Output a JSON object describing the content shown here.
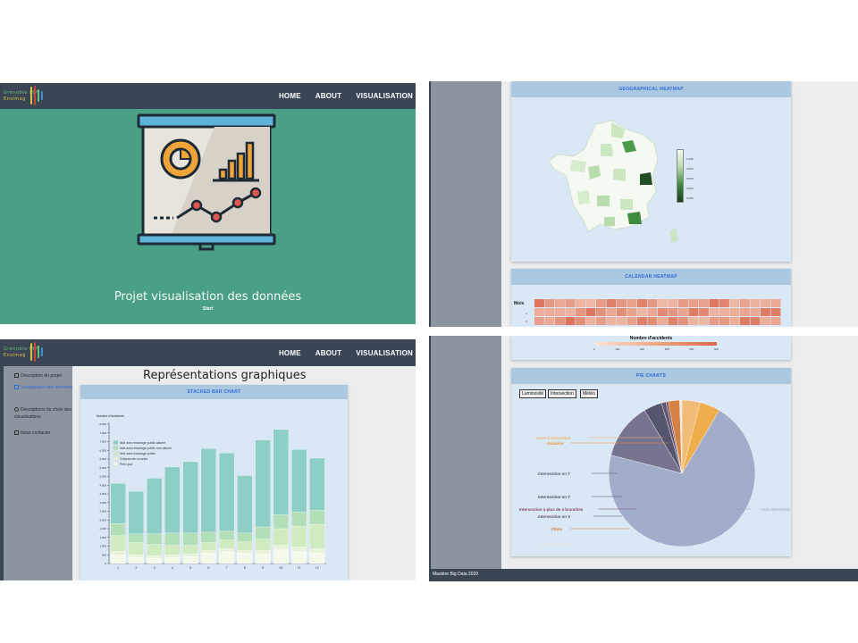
{
  "nav": {
    "logo_line1": "Grenoble INP",
    "logo_line2": "Ensimag",
    "links": [
      "HOME",
      "ABOUT",
      "VISUALISATION"
    ]
  },
  "home": {
    "title": "Projet visualisation des données",
    "start": "Start"
  },
  "geo_map": {
    "header": "GEOGRAPHICAL HEATMAP",
    "legend_ticks": [
      "1,000",
      "2,000",
      "3,000",
      "4,000",
      "5,000"
    ]
  },
  "calendar": {
    "header": "CALENDAR HEATMAP",
    "y_label": "Mois",
    "row_labels": [
      "2",
      "3",
      "4"
    ],
    "legend_title": "Nombre d'accidents",
    "legend_ticks": [
      "0",
      "100",
      "200",
      "300",
      "400",
      "500"
    ],
    "colors": {
      "low": "#fbe4d6",
      "high": "#d9684e"
    }
  },
  "sidebar": {
    "items": [
      {
        "label": "Description du projet",
        "active": false
      },
      {
        "label": "Visualisation des données",
        "active": true
      },
      {
        "label": "Descriptions du choix des visualisations",
        "active": false
      },
      {
        "label": "Nous contacter",
        "active": false
      }
    ]
  },
  "viz_page": {
    "title": "Représentations graphiques"
  },
  "stacked_card": {
    "header": "STACKED BAR CHART"
  },
  "pie_card": {
    "header": "PIE CHARTS",
    "buttons": [
      "Luminosité",
      "Intersection",
      "Météo"
    ]
  },
  "footer": {
    "text": "Mastère Big Data 2020"
  },
  "chart_data": [
    {
      "type": "bar",
      "stacked": true,
      "ylabel": "Nombre d'accidents",
      "categories": [
        "1",
        "2",
        "3",
        "4",
        "5",
        "6",
        "7",
        "8",
        "9",
        "10",
        "11",
        "12"
      ],
      "ylim": [
        0,
        8000
      ],
      "y_ticks": [
        "0",
        "500",
        "1,000",
        "1,500",
        "2,000",
        "2,500",
        "3,000",
        "3,500",
        "4,000",
        "4,500",
        "5,000",
        "5,500",
        "6,000",
        "6,500",
        "7,000",
        "7,500",
        "8,000"
      ],
      "series": [
        {
          "name": "Plein jour",
          "color": "#f4f9ea",
          "values": [
            500,
            350,
            300,
            350,
            400,
            600,
            700,
            600,
            550,
            800,
            700,
            600
          ]
        },
        {
          "name": "Crépuscule ou aube",
          "color": "#e7f3d6",
          "values": [
            200,
            150,
            150,
            150,
            150,
            150,
            150,
            150,
            200,
            250,
            250,
            250
          ]
        },
        {
          "name": "Nuit sans éclairage public",
          "color": "#d1ebc0",
          "values": [
            900,
            700,
            650,
            550,
            500,
            450,
            500,
            500,
            650,
            950,
            1200,
            1400
          ]
        },
        {
          "name": "Nuit avec éclairage public non allumé",
          "color": "#b3dfb8",
          "values": [
            700,
            500,
            600,
            700,
            700,
            600,
            500,
            500,
            700,
            800,
            800,
            800
          ]
        },
        {
          "name": "Nuit avec éclairage public allumé",
          "color": "#8ecfc5",
          "values": [
            2300,
            2450,
            3200,
            3800,
            4100,
            4800,
            4500,
            3300,
            5000,
            4900,
            3600,
            3000
          ]
        }
      ]
    },
    {
      "type": "pie",
      "categories": [
        "Hors intersection",
        "Intersection en T",
        "Intersection en Y",
        "Intersection en X",
        "Intersection à plus de 4 branches",
        "Place",
        "Passage à niveau",
        "Autre intersection",
        "Giratoire"
      ],
      "values": [
        70.5,
        12.5,
        4.0,
        1.0,
        0.5,
        2.5,
        0.5,
        4.0,
        4.5
      ],
      "colors": [
        "#9ca8c7",
        "#6e6a88",
        "#4b4963",
        "#5a4d63",
        "#7a4a59",
        "#d67a33",
        "#ece7e3",
        "#f2b86c",
        "#f1a83c"
      ]
    }
  ]
}
